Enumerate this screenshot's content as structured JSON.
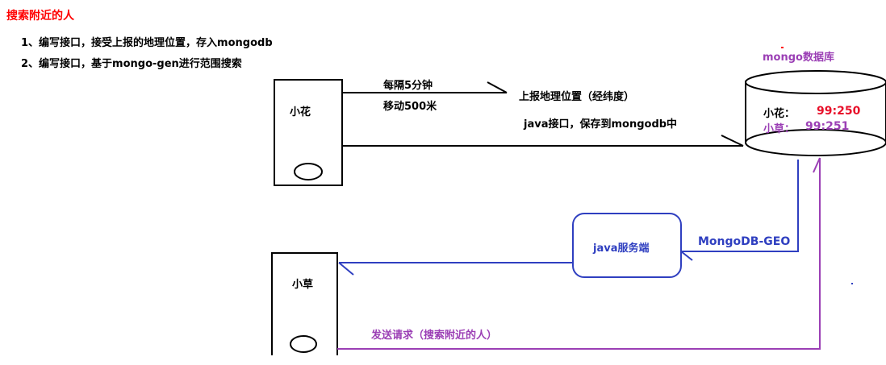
{
  "title": "搜索附近的人",
  "steps": [
    "1、编写接口，接受上报的地理位置，存入mongodb",
    "2、编写接口，基于mongo-gen进行范围搜索"
  ],
  "db": {
    "title": "mongo数据库",
    "rows": [
      {
        "name": "小花：",
        "value": "99:250"
      },
      {
        "name": "小草：",
        "value": "99:251"
      }
    ]
  },
  "devices": {
    "top": "小花",
    "bottom": "小草"
  },
  "arrows": {
    "interval_line1": "每隔5分钟",
    "interval_line2": "移动500米",
    "report": "上报地理位置（经纬度）",
    "java_api": "java接口，保存到mongodb中",
    "geo": "MongoDB-GEO",
    "request": "发送请求（搜索附近的人）"
  },
  "server": {
    "label": "java服务端"
  },
  "colors": {
    "title": "#ff0000",
    "purple": "#9b3fb5",
    "blue": "#2f3fc0",
    "value_red": "#e8102a"
  }
}
